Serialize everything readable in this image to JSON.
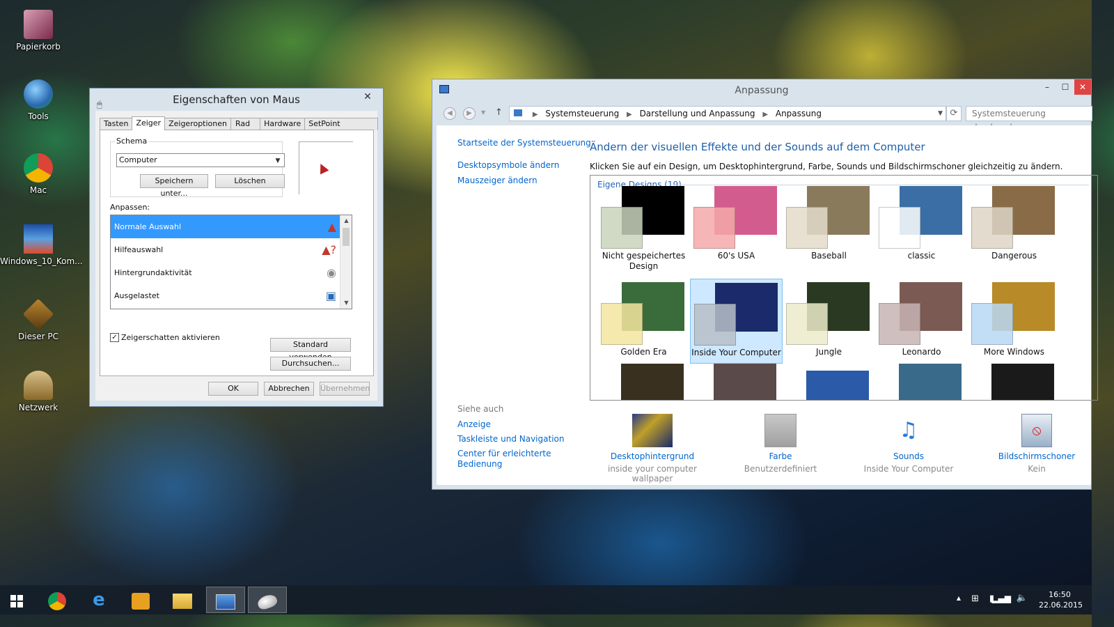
{
  "desktop": {
    "icons": [
      {
        "label": "Papierkorb"
      },
      {
        "label": "Tools"
      },
      {
        "label": "Mac"
      },
      {
        "label": "Windows_10_Kom..."
      },
      {
        "label": "Dieser PC"
      },
      {
        "label": "Netzwerk"
      }
    ]
  },
  "mouse_dialog": {
    "title": "Eigenschaften von Maus",
    "close_label": "✕",
    "tabs": [
      "Tasten",
      "Zeiger",
      "Zeigeroptionen",
      "Rad",
      "Hardware",
      "SetPoint Settings"
    ],
    "active_tab": "Zeiger",
    "schema_label": "Schema",
    "schema_value": "Computer",
    "save_as_label": "Speichern unter...",
    "delete_label": "Löschen",
    "customize_label": "Anpassen:",
    "cursors": [
      {
        "name": "Normale Auswahl",
        "glyph": "▲"
      },
      {
        "name": "Hilfeauswahl",
        "glyph": "▲?"
      },
      {
        "name": "Hintergrundaktivität",
        "glyph": "◉"
      },
      {
        "name": "Ausgelastet",
        "glyph": "▣"
      }
    ],
    "shadow_label": "Zeigerschatten aktivieren",
    "shadow_checked": true,
    "default_label": "Standard verwenden",
    "browse_label": "Durchsuchen...",
    "ok_label": "OK",
    "cancel_label": "Abbrechen",
    "apply_label": "Übernehmen"
  },
  "personalize": {
    "title": "Anpassung",
    "breadcrumb": [
      "Systemsteuerung",
      "Darstellung und Anpassung",
      "Anpassung"
    ],
    "search_placeholder": "Systemsteuerung durchsuchen",
    "sidebar_links": [
      "Startseite der Systemsteuerung",
      "Desktopsymbole ändern",
      "Mauszeiger ändern"
    ],
    "heading": "Ändern der visuellen Effekte und der Sounds auf dem Computer",
    "subheading": "Klicken Sie auf ein Design, um Desktophintergrund, Farbe, Sounds und Bildschirmschoner gleichzeitig zu ändern.",
    "group_label": "Eigene Designs (19)",
    "themes": [
      {
        "name": "Nicht gespeichertes Design",
        "bg": "#000000",
        "swatch": "#c8d4bc"
      },
      {
        "name": "60's USA",
        "bg": "#d35c8e",
        "swatch": "#f5aaaa"
      },
      {
        "name": "Baseball",
        "bg": "#8a7a5c",
        "swatch": "#e4dccb"
      },
      {
        "name": "classic",
        "bg": "#3a6ea5",
        "swatch": "#ffffff"
      },
      {
        "name": "Dangerous",
        "bg": "#8a6b48",
        "swatch": "#ddd5c6"
      },
      {
        "name": "Golden Era",
        "bg": "#3a6b3a",
        "swatch": "#f5e6a0"
      },
      {
        "name": "Inside Your Computer",
        "bg": "#1a2a6a",
        "swatch": "#b8c0c8"
      },
      {
        "name": "Jungle",
        "bg": "#2a3a22",
        "swatch": "#eeeccb"
      },
      {
        "name": "Leonardo",
        "bg": "#7a5a52",
        "swatch": "#c8b4b4"
      },
      {
        "name": "More Windows",
        "bg": "#b88a28",
        "swatch": "#b8d8f5"
      }
    ],
    "selected_theme": "Inside Your Computer",
    "see_also_label": "Siehe auch",
    "see_also_links": [
      "Anzeige",
      "Taskleiste und Navigation",
      "Center für erleichterte Bedienung"
    ],
    "bottom_items": [
      {
        "title": "Desktophintergrund",
        "subtitle": "inside your computer wallpaper"
      },
      {
        "title": "Farbe",
        "subtitle": "Benutzerdefiniert"
      },
      {
        "title": "Sounds",
        "subtitle": "Inside Your Computer"
      },
      {
        "title": "Bildschirmschoner",
        "subtitle": "Kein"
      }
    ]
  },
  "taskbar": {
    "apps": [
      "start-icon",
      "chrome-icon",
      "internet-explorer-icon",
      "outlook-icon",
      "file-explorer-icon",
      "control-panel-icon",
      "mouse-icon"
    ],
    "time": "16:50",
    "date": "22.06.2015"
  }
}
